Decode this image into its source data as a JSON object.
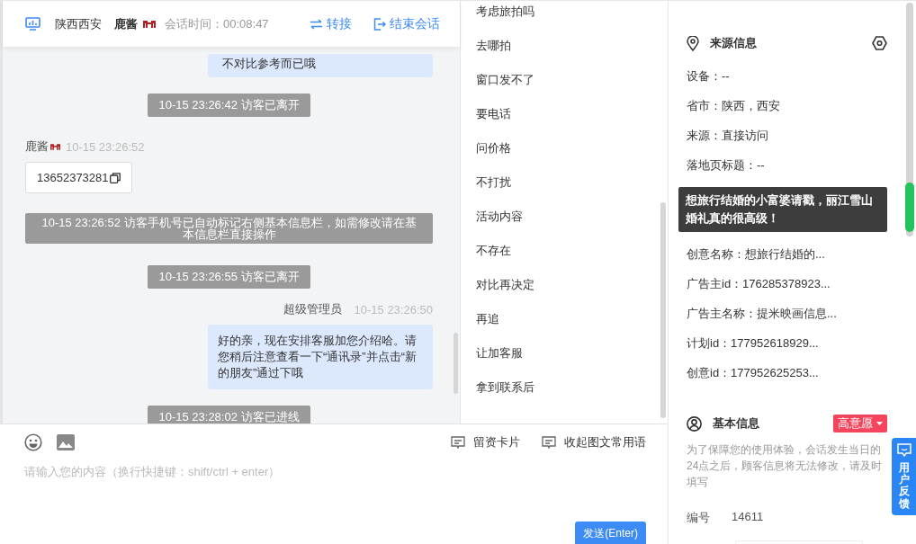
{
  "header": {
    "location": "陕西西安",
    "agent_name": "鹿酱",
    "session_time": "会话时间：00:08:47",
    "transfer": "转接",
    "end_session": "结束会话"
  },
  "messages": [
    {
      "kind": "outgoing",
      "text": "不对比参考而已哦"
    },
    {
      "kind": "notice",
      "text": "10-15 23:26:42 访客已离开"
    },
    {
      "kind": "incoming",
      "sender": "鹿酱",
      "time": "10-15 23:26:52",
      "text": "13652373281"
    },
    {
      "kind": "notice",
      "text": "10-15 23:26:52 访客手机号已自动标记右侧基本信息栏，如需修改请在基本信息栏直接操作"
    },
    {
      "kind": "notice",
      "text": "10-15 23:26:55 访客已离开"
    },
    {
      "kind": "outgoing",
      "sender": "超级管理员",
      "time": "10-15 23:26:50",
      "text": "好的亲，现在安排客服加您介绍哈。请您稍后注意查看一下“通讯录”并点击“新的朋友”通过下哦"
    },
    {
      "kind": "notice",
      "text": "10-15 23:28:02 访客已进线"
    }
  ],
  "phrases": [
    "考虑旅拍吗",
    "去哪拍",
    "窗口发不了",
    "要电话",
    "问价格",
    "不打扰",
    "活动内容",
    "不存在",
    "对比再决定",
    "再追",
    "让加客服",
    "拿到联系后"
  ],
  "composer": {
    "card_button": "留资卡片",
    "collapse_button": "收起图文常用语",
    "placeholder": "请输入您的内容（换行快捷键：shift/ctrl + enter）",
    "send_button": "发送(Enter)"
  },
  "source_info": {
    "title": "来源信息",
    "rows_before_tooltip": [
      "设备：--",
      "省市：陕西，西安",
      "来源：直接访问",
      "落地页标题：--"
    ],
    "rows": [
      "创意名称：想旅行结婚的...",
      "广告主id：176285378923...",
      "广告主名称：提米映画信息...",
      "计划id：177952618929...",
      "创意id：177952625253..."
    ]
  },
  "tooltip": "想旅行结婚的小富婆请戳，丽江雪山婚礼真的很高级！",
  "basic_info": {
    "title": "基本信息",
    "intent_tag": "高意愿",
    "notice": "为了保障您的使用体验，会话发生当日的24点之后，顾客信息将无法修改，请及时填写",
    "id_label": "编号",
    "id_value": "14611"
  },
  "feedback_button": "用户反馈"
}
